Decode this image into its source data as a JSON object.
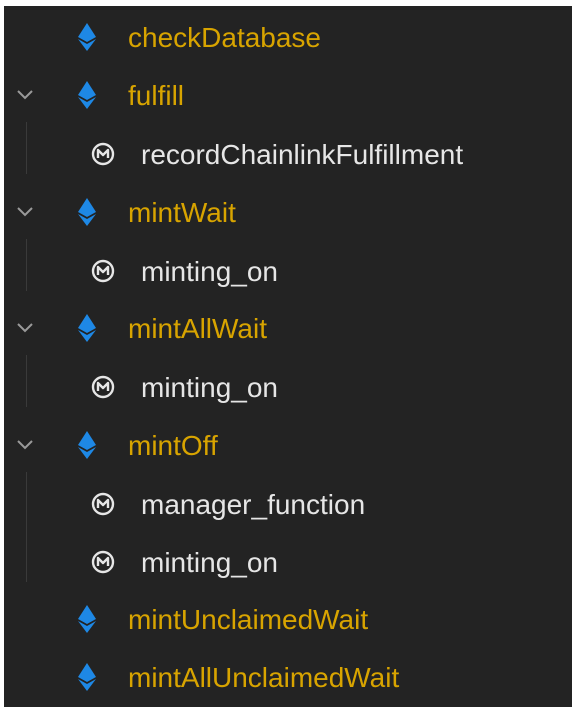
{
  "colors": {
    "background": "#232323",
    "function_label": "#d8a400",
    "modifier_label": "#e6e6e6",
    "ethereum_icon": "#1e88e5",
    "twistie": "#9a9a9a"
  },
  "tree": {
    "items": [
      {
        "type": "function",
        "label": "checkDatabase",
        "expanded": false,
        "icon": "ethereum-diamond-icon"
      },
      {
        "type": "function",
        "label": "fulfill",
        "expanded": true,
        "icon": "ethereum-diamond-icon"
      },
      {
        "type": "modifier",
        "label": "recordChainlinkFulfillment",
        "icon": "modifier-icon"
      },
      {
        "type": "function",
        "label": "mintWait",
        "expanded": true,
        "icon": "ethereum-diamond-icon"
      },
      {
        "type": "modifier",
        "label": "minting_on",
        "icon": "modifier-icon"
      },
      {
        "type": "function",
        "label": "mintAllWait",
        "expanded": true,
        "icon": "ethereum-diamond-icon"
      },
      {
        "type": "modifier",
        "label": "minting_on",
        "icon": "modifier-icon"
      },
      {
        "type": "function",
        "label": "mintOff",
        "expanded": true,
        "icon": "ethereum-diamond-icon"
      },
      {
        "type": "modifier",
        "label": "manager_function",
        "icon": "modifier-icon"
      },
      {
        "type": "modifier",
        "label": "minting_on",
        "icon": "modifier-icon"
      },
      {
        "type": "function",
        "label": "mintUnclaimedWait",
        "expanded": false,
        "icon": "ethereum-diamond-icon"
      },
      {
        "type": "function",
        "label": "mintAllUnclaimedWait",
        "expanded": false,
        "icon": "ethereum-diamond-icon"
      }
    ]
  }
}
